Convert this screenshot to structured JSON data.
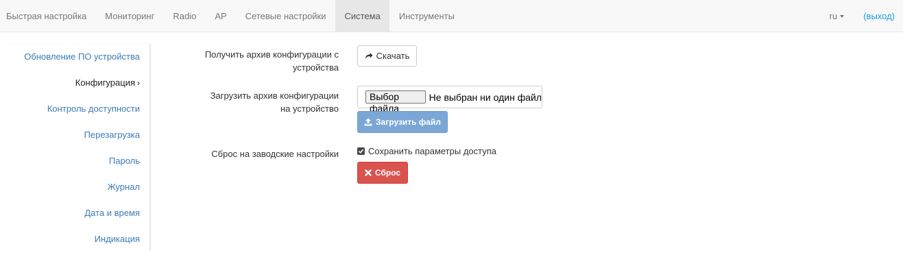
{
  "navbar": {
    "tabs": [
      {
        "label": "Быстрая настройка"
      },
      {
        "label": "Мониторинг"
      },
      {
        "label": "Radio"
      },
      {
        "label": "AP"
      },
      {
        "label": "Сетевые настройки"
      },
      {
        "label": "Система",
        "active": true
      },
      {
        "label": "Инструменты"
      }
    ],
    "language": "ru",
    "logout": "(выход)"
  },
  "sidebar": {
    "items": [
      {
        "label": "Обновление ПО устройства"
      },
      {
        "label": "Конфигурация",
        "active": true,
        "suffix": "›"
      },
      {
        "label": "Контроль доступности"
      },
      {
        "label": "Перезагрузка"
      },
      {
        "label": "Пароль"
      },
      {
        "label": "Журнал"
      },
      {
        "label": "Дата и время"
      },
      {
        "label": "Индикация"
      }
    ]
  },
  "form": {
    "download_label": "Получить архив конфигурации с устройства",
    "download_button": "Скачать",
    "upload_label": "Загрузить архив конфигурации на устройство",
    "file_choose_button": "Выбор файла",
    "file_status": "Не выбран ни один файл",
    "upload_button": "Загрузить файл",
    "reset_label": "Сброс на заводские настройки",
    "keep_access_label": "Сохранить параметры доступа",
    "keep_access_checked": true,
    "reset_button": "Сброс"
  },
  "colors": {
    "link": "#3c7bb6",
    "logout": "#1c9cd9",
    "upload_button": "#7aa7d6",
    "reset_button": "#d9534f"
  },
  "icons": {
    "download": "share-arrow-icon",
    "upload": "upload-icon",
    "reset": "close-icon",
    "checkbox": "checkmark-icon"
  }
}
